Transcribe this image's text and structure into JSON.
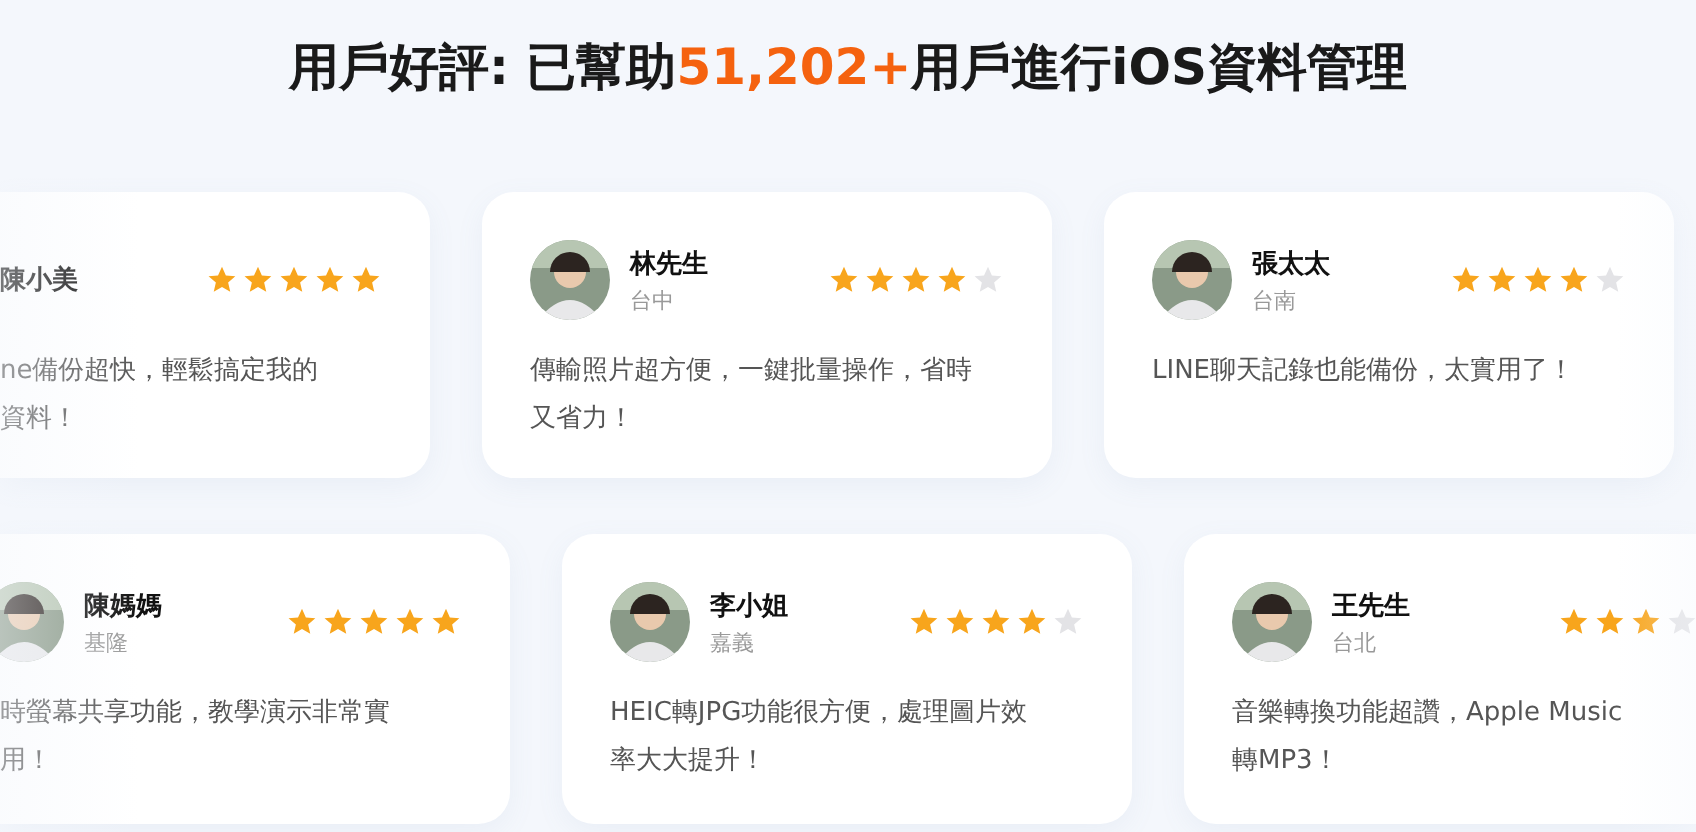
{
  "heading": {
    "before": "用戶好評: 已幫助",
    "highlight": "51,202+",
    "after": "用戶進行iOS資料管理"
  },
  "rows": [
    {
      "cards": [
        {
          "kind": "cut-left",
          "avatar": false,
          "name": "陳小美",
          "stars": 5,
          "text": "ne備份超快，輕鬆搞定我的資料！"
        },
        {
          "kind": "full",
          "avatar": true,
          "name": "林先生",
          "location": "台中",
          "stars": 4,
          "text": "傳輸照片超方便，一鍵批量操作，省時又省力！"
        },
        {
          "kind": "full",
          "avatar": true,
          "name": "張太太",
          "location": "台南",
          "stars": 4,
          "text": "LINE聊天記錄也能備份，太實用了！"
        }
      ]
    },
    {
      "cards": [
        {
          "kind": "cut-left",
          "avatar": true,
          "name": "陳媽媽",
          "location": "基隆",
          "stars": 5,
          "text": "時螢幕共享功能，教學演示非常實用！"
        },
        {
          "kind": "full",
          "avatar": true,
          "name": "李小姐",
          "location": "嘉義",
          "stars": 4,
          "text": "HEIC轉JPG功能很方便，處理圖片效率大大提升！"
        },
        {
          "kind": "cut-right",
          "avatar": true,
          "name": "王先生",
          "location": "台北",
          "stars": 3,
          "text": "音樂轉換功能超讚，Apple Music轉MP3！"
        }
      ]
    }
  ]
}
